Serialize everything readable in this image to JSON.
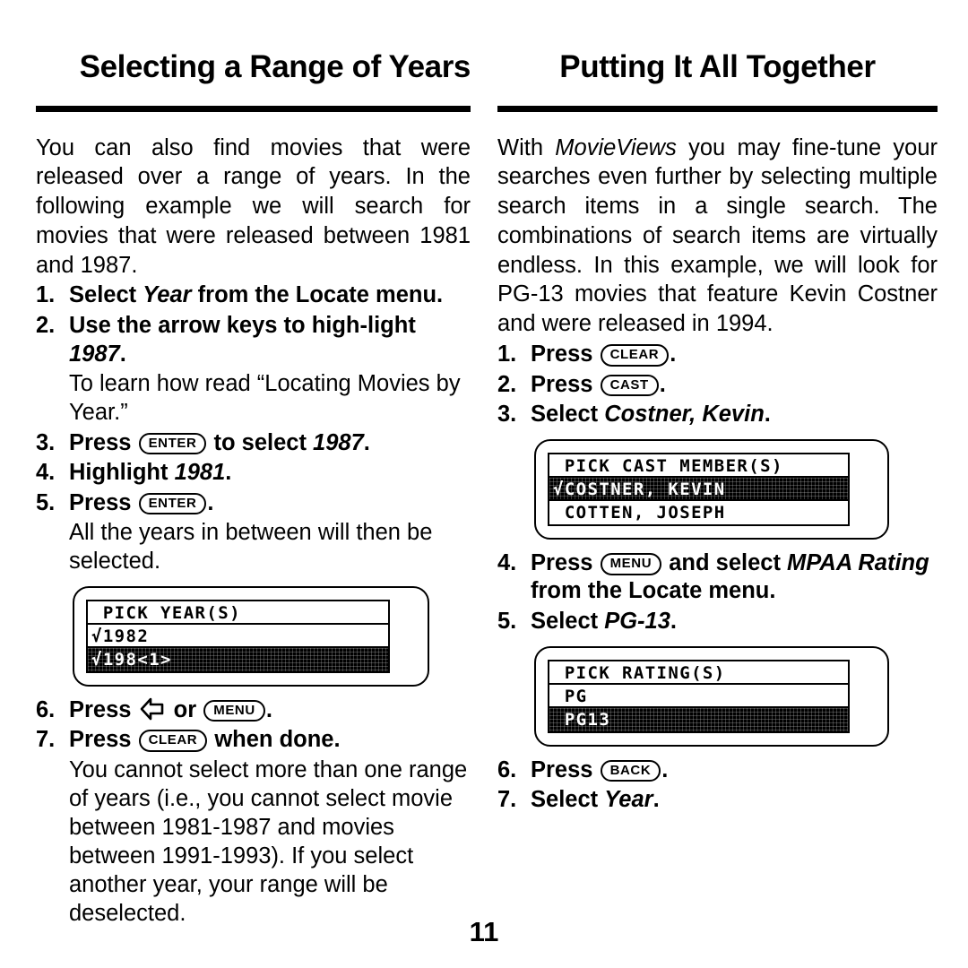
{
  "page_number": "11",
  "left_column": {
    "heading": "Selecting a Range of Years",
    "intro": "You can also find movies that were released over a range of years. In the following example we will search for movies that were released between 1981 and 1987.",
    "steps": [
      {
        "num": "1.",
        "parts": [
          {
            "text": "Select ",
            "style": "bold"
          },
          {
            "text": "Year",
            "style": "bold-italic"
          },
          {
            "text": " from the Locate menu.",
            "style": "bold"
          }
        ]
      },
      {
        "num": "2.",
        "parts": [
          {
            "text": "Use the arrow keys to high-light ",
            "style": "bold"
          },
          {
            "text": "1987",
            "style": "bold-italic"
          },
          {
            "text": ".",
            "style": "bold"
          }
        ],
        "note": "To learn how read “Locating Movies by Year.”"
      },
      {
        "num": "3.",
        "parts": [
          {
            "text": "Press ",
            "style": "bold"
          },
          {
            "text": "ENTER",
            "style": "key"
          },
          {
            "text": " to select ",
            "style": "bold"
          },
          {
            "text": "1987",
            "style": "bold-italic"
          },
          {
            "text": ".",
            "style": "bold"
          }
        ]
      },
      {
        "num": "4.",
        "parts": [
          {
            "text": "Highlight ",
            "style": "bold"
          },
          {
            "text": "1981",
            "style": "bold-italic"
          },
          {
            "text": ".",
            "style": "bold"
          }
        ]
      },
      {
        "num": "5.",
        "parts": [
          {
            "text": "Press ",
            "style": "bold"
          },
          {
            "text": "ENTER",
            "style": "key"
          },
          {
            "text": ".",
            "style": "bold"
          }
        ],
        "note": "All the years in between will then be selected."
      }
    ],
    "lcd": {
      "name": "pick-years-screen",
      "title": "PICK YEAR(S)",
      "rows": [
        {
          "text": "√1982",
          "selected": false
        },
        {
          "text": "√198<1>",
          "selected": true
        }
      ]
    },
    "steps_after": [
      {
        "num": "6.",
        "parts": [
          {
            "text": "Press ",
            "style": "bold"
          },
          {
            "text": "left-arrow",
            "style": "arrow"
          },
          {
            "text": " or ",
            "style": "bold"
          },
          {
            "text": "MENU",
            "style": "key"
          },
          {
            "text": ".",
            "style": "bold"
          }
        ]
      },
      {
        "num": "7.",
        "parts": [
          {
            "text": "Press ",
            "style": "bold"
          },
          {
            "text": "CLEAR",
            "style": "key"
          },
          {
            "text": " when done.",
            "style": "bold"
          }
        ],
        "note": "You cannot select more than one range of years (i.e., you cannot select movie between 1981-1987 and movies between 1991-1993). If you select another year, your range will be deselected."
      }
    ]
  },
  "right_column": {
    "heading": "Putting It All Together",
    "intro_parts": [
      {
        "text": "With ",
        "style": "normal"
      },
      {
        "text": "MovieViews",
        "style": "italic"
      },
      {
        "text": " you may fine-tune your searches even further by selecting multiple search items in a single search. The combinations of search items are virtually endless. In this example, we will look for PG-13 movies that feature Kevin Costner and were released in 1994.",
        "style": "normal"
      }
    ],
    "steps": [
      {
        "num": "1.",
        "parts": [
          {
            "text": "Press ",
            "style": "bold"
          },
          {
            "text": "CLEAR",
            "style": "key"
          },
          {
            "text": ".",
            "style": "bold"
          }
        ]
      },
      {
        "num": "2.",
        "parts": [
          {
            "text": "Press ",
            "style": "bold"
          },
          {
            "text": "CAST",
            "style": "key"
          },
          {
            "text": ".",
            "style": "bold"
          }
        ]
      },
      {
        "num": "3.",
        "parts": [
          {
            "text": "Select ",
            "style": "bold"
          },
          {
            "text": "Costner, Kevin",
            "style": "bold-italic"
          },
          {
            "text": ".",
            "style": "bold"
          }
        ]
      }
    ],
    "lcd_cast": {
      "name": "pick-cast-screen",
      "title": "PICK CAST MEMBER(S)",
      "rows": [
        {
          "text": "√COSTNER, KEVIN",
          "selected": true
        },
        {
          "text": " COTTEN, JOSEPH",
          "selected": false
        }
      ]
    },
    "steps_mid": [
      {
        "num": "4.",
        "parts": [
          {
            "text": "Press ",
            "style": "bold"
          },
          {
            "text": "MENU",
            "style": "key"
          },
          {
            "text": " and select ",
            "style": "bold"
          },
          {
            "text": "MPAA Rating",
            "style": "bold-italic"
          },
          {
            "text": " from the Locate menu.",
            "style": "bold"
          }
        ]
      },
      {
        "num": "5.",
        "parts": [
          {
            "text": "Select ",
            "style": "bold"
          },
          {
            "text": "PG-13",
            "style": "bold-italic"
          },
          {
            "text": ".",
            "style": "bold"
          }
        ]
      }
    ],
    "lcd_rating": {
      "name": "pick-rating-screen",
      "title": "PICK RATING(S)",
      "rows": [
        {
          "text": " PG",
          "selected": false
        },
        {
          "text": " PG13",
          "selected": true
        }
      ]
    },
    "steps_after": [
      {
        "num": "6.",
        "parts": [
          {
            "text": "Press ",
            "style": "bold"
          },
          {
            "text": "BACK",
            "style": "key"
          },
          {
            "text": ".",
            "style": "bold"
          }
        ]
      },
      {
        "num": "7.",
        "parts": [
          {
            "text": "Select ",
            "style": "bold"
          },
          {
            "text": "Year",
            "style": "bold-italic"
          },
          {
            "text": ".",
            "style": "bold"
          }
        ]
      }
    ]
  }
}
